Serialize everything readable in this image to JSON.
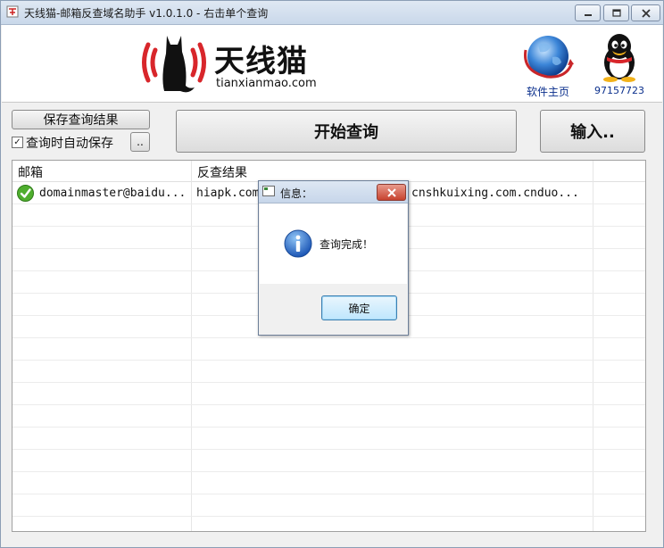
{
  "window": {
    "title": "天线猫-邮箱反查域名助手 v1.0.1.0 - 右击单个查询",
    "controls": {
      "minimize": "minimize-icon",
      "maximize": "maximize-icon",
      "close": "close-icon"
    }
  },
  "banner": {
    "logo_cn": "天线猫",
    "logo_en": "tianxianmao.com",
    "home_label": "软件主页",
    "qq_label": "97157723"
  },
  "toolbar": {
    "save_results_label": "保存查询结果",
    "auto_save_label": "查询时自动保存",
    "auto_save_checked": true,
    "browse_label": "..",
    "start_label": "开始查询",
    "input_label": "输入.."
  },
  "table": {
    "columns": [
      "邮箱",
      "反查结果"
    ],
    "rows": [
      {
        "email": "domainmaster@baidu...",
        "result_left": "hiapk.com",
        "result_right": "cnshkuixing.com.cnduo...",
        "status": "ok"
      }
    ]
  },
  "dialog": {
    "title": "信息：",
    "message": "查询完成！",
    "ok_label": "确定",
    "icon": "info-icon"
  },
  "colors": {
    "link_blue": "#0a2f8c",
    "logo_red": "#d8262b",
    "titlebar": "#c9d8ea"
  }
}
